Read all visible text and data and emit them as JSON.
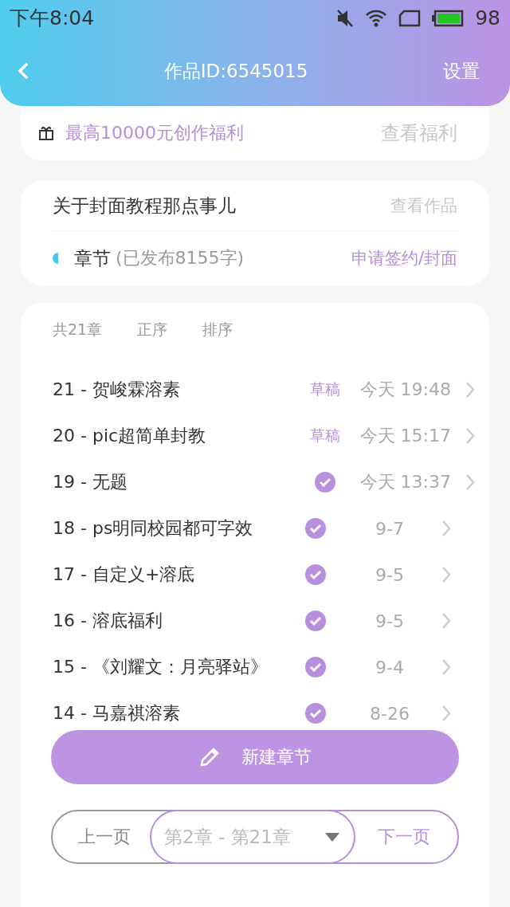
{
  "status_bar": {
    "time": "下午8:04",
    "battery": "98"
  },
  "header": {
    "title": "作品ID:6545015",
    "action": "设置"
  },
  "promo": {
    "text": "最高10000元创作福利",
    "link": "查看福利"
  },
  "work": {
    "title": "关于封面教程那点事儿",
    "link": "查看作品",
    "section": "章节",
    "note": "(已发布8155字)",
    "apply": "申请签约/封面"
  },
  "list_header": {
    "count": "共21章",
    "options": [
      "正序",
      "排序"
    ]
  },
  "chapters": [
    {
      "title": "21 - 贺峻霖溶素",
      "kind": "draft",
      "status": "草稿",
      "date": "今天 19:48"
    },
    {
      "title": "20 - pic超简单封教",
      "kind": "draft",
      "status": "草稿",
      "date": "今天 15:17"
    },
    {
      "title": "19 - 无题",
      "kind": "published",
      "date": "今天 13:37"
    },
    {
      "title": "18 - ps明同校园都可字效",
      "kind": "published",
      "date": "9-7"
    },
    {
      "title": "17 - 自定义+溶底",
      "kind": "published",
      "date": "9-5"
    },
    {
      "title": "16 - 溶底福利",
      "kind": "published",
      "date": "9-5"
    },
    {
      "title": "15 - 《刘耀文：月亮驿站》",
      "kind": "published",
      "date": "9-4"
    },
    {
      "title": "14 - 马嘉祺溶素",
      "kind": "published",
      "date": "8-26"
    }
  ],
  "new_button": "新建章节",
  "pager": {
    "prev": {
      "label": "上一页",
      "disabled": true
    },
    "range": "第2章 - 第21章",
    "next": {
      "label": "下一页",
      "disabled": false
    }
  }
}
